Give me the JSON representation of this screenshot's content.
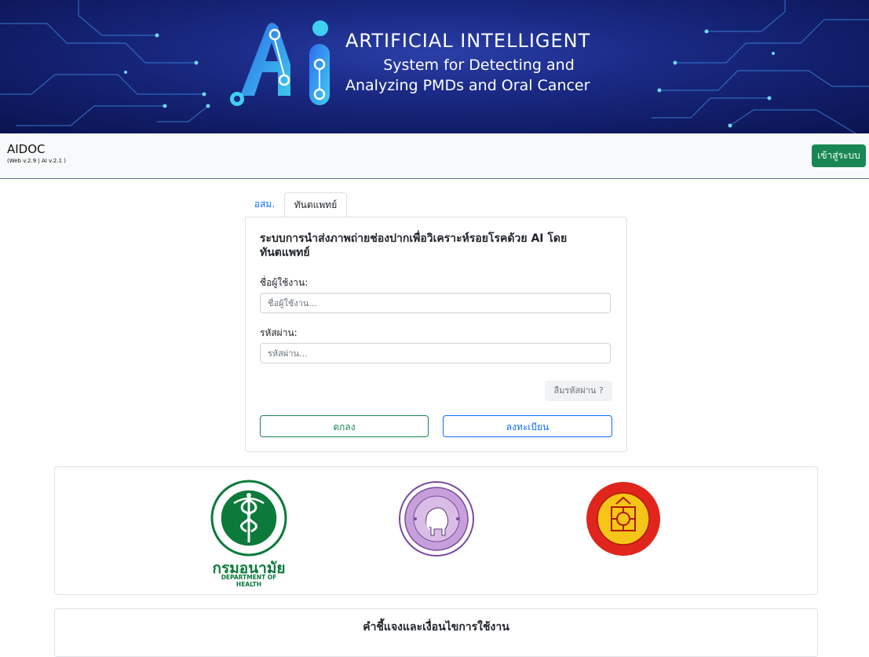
{
  "banner": {
    "title": "ARTIFICIAL INTELLIGENT",
    "subtitle_line1": "System for Detecting and",
    "subtitle_line2": "Analyzing PMDs and Oral Cancer",
    "logo_icon": "ai-logo-icon"
  },
  "navbar": {
    "brand": "AIDOC",
    "version": "(Web v.2.9 | AI v.2.1 )",
    "login_label": "เข้าสู่ระบบ"
  },
  "tabs": [
    {
      "label": "อสม."
    },
    {
      "label": "ทันตแพทย์"
    }
  ],
  "form": {
    "title": "ระบบการนำส่งภาพถ่ายช่องปากเพื่อวิเคราะห์รอยโรคด้วย AI โดยทันตแพทย์",
    "username_label": "ชื่อผู้ใช้งาน:",
    "username_placeholder": "ชื่อผู้ใช้งาน...",
    "password_label": "รหัสผ่าน:",
    "password_placeholder": "รหัสผ่าน...",
    "forgot_label": "ลืมรหัสผ่าน ?",
    "ok_label": "ตกลง",
    "register_label": "ลงทะเบียน"
  },
  "partners": {
    "doh_name": "กรมอนามัย",
    "doh_english": "DEPARTMENT OF HEALTH"
  },
  "terms": {
    "title": "คำชี้แจงและเงื่อนไขการใช้งาน"
  },
  "colors": {
    "success": "#198754",
    "primary": "#0d6efd",
    "banner_dark": "#101b63",
    "banner_accent": "#3fd0f0"
  }
}
